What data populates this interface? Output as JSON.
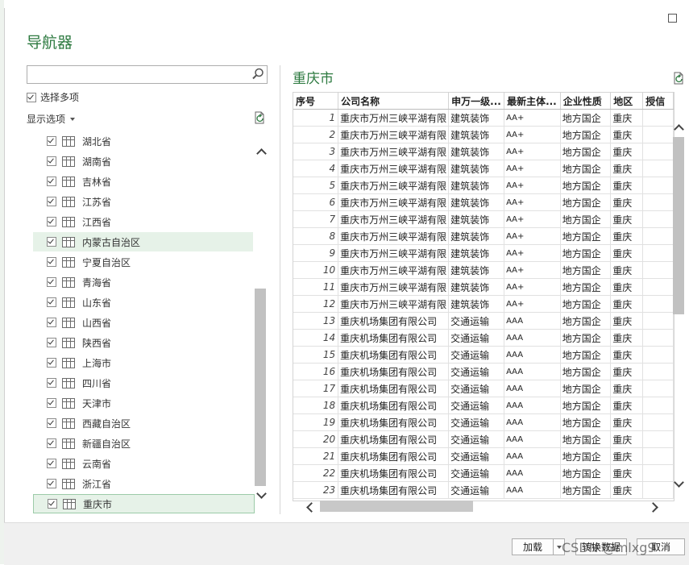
{
  "dialog": {
    "title": "导航器"
  },
  "left": {
    "search_placeholder": "",
    "select_multiple_label": "选择多项",
    "display_options_label": "显示选项",
    "items": [
      {
        "label": "湖北省",
        "checked": true
      },
      {
        "label": "湖南省",
        "checked": true
      },
      {
        "label": "吉林省",
        "checked": true
      },
      {
        "label": "江苏省",
        "checked": true
      },
      {
        "label": "江西省",
        "checked": true
      },
      {
        "label": "内蒙古自治区",
        "checked": true,
        "state": "hover"
      },
      {
        "label": "宁夏自治区",
        "checked": true
      },
      {
        "label": "青海省",
        "checked": true
      },
      {
        "label": "山东省",
        "checked": true
      },
      {
        "label": "山西省",
        "checked": true
      },
      {
        "label": "陕西省",
        "checked": true
      },
      {
        "label": "上海市",
        "checked": true
      },
      {
        "label": "四川省",
        "checked": true
      },
      {
        "label": "天津市",
        "checked": true
      },
      {
        "label": "西藏自治区",
        "checked": true
      },
      {
        "label": "新疆自治区",
        "checked": true
      },
      {
        "label": "云南省",
        "checked": true
      },
      {
        "label": "浙江省",
        "checked": true
      },
      {
        "label": "重庆市",
        "checked": true,
        "state": "selected"
      }
    ]
  },
  "preview": {
    "title": "重庆市",
    "columns": [
      "序号",
      "公司名称",
      "申万一级...",
      "最新主体...",
      "企业性质",
      "地区",
      "授信"
    ],
    "rows": [
      [
        "1",
        "重庆市万州三峡平湖有限",
        "建筑装饰",
        "AA+",
        "地方国企",
        "重庆"
      ],
      [
        "2",
        "重庆市万州三峡平湖有限",
        "建筑装饰",
        "AA+",
        "地方国企",
        "重庆"
      ],
      [
        "3",
        "重庆市万州三峡平湖有限",
        "建筑装饰",
        "AA+",
        "地方国企",
        "重庆"
      ],
      [
        "4",
        "重庆市万州三峡平湖有限",
        "建筑装饰",
        "AA+",
        "地方国企",
        "重庆"
      ],
      [
        "5",
        "重庆市万州三峡平湖有限",
        "建筑装饰",
        "AA+",
        "地方国企",
        "重庆"
      ],
      [
        "6",
        "重庆市万州三峡平湖有限",
        "建筑装饰",
        "AA+",
        "地方国企",
        "重庆"
      ],
      [
        "7",
        "重庆市万州三峡平湖有限",
        "建筑装饰",
        "AA+",
        "地方国企",
        "重庆"
      ],
      [
        "8",
        "重庆市万州三峡平湖有限",
        "建筑装饰",
        "AA+",
        "地方国企",
        "重庆"
      ],
      [
        "9",
        "重庆市万州三峡平湖有限",
        "建筑装饰",
        "AA+",
        "地方国企",
        "重庆"
      ],
      [
        "10",
        "重庆市万州三峡平湖有限",
        "建筑装饰",
        "AA+",
        "地方国企",
        "重庆"
      ],
      [
        "11",
        "重庆市万州三峡平湖有限",
        "建筑装饰",
        "AA+",
        "地方国企",
        "重庆"
      ],
      [
        "12",
        "重庆市万州三峡平湖有限",
        "建筑装饰",
        "AA+",
        "地方国企",
        "重庆"
      ],
      [
        "13",
        "重庆机场集团有限公司",
        "交通运输",
        "AAA",
        "地方国企",
        "重庆"
      ],
      [
        "14",
        "重庆机场集团有限公司",
        "交通运输",
        "AAA",
        "地方国企",
        "重庆"
      ],
      [
        "15",
        "重庆机场集团有限公司",
        "交通运输",
        "AAA",
        "地方国企",
        "重庆"
      ],
      [
        "16",
        "重庆机场集团有限公司",
        "交通运输",
        "AAA",
        "地方国企",
        "重庆"
      ],
      [
        "17",
        "重庆机场集团有限公司",
        "交通运输",
        "AAA",
        "地方国企",
        "重庆"
      ],
      [
        "18",
        "重庆机场集团有限公司",
        "交通运输",
        "AAA",
        "地方国企",
        "重庆"
      ],
      [
        "19",
        "重庆机场集团有限公司",
        "交通运输",
        "AAA",
        "地方国企",
        "重庆"
      ],
      [
        "20",
        "重庆机场集团有限公司",
        "交通运输",
        "AAA",
        "地方国企",
        "重庆"
      ],
      [
        "21",
        "重庆机场集团有限公司",
        "交通运输",
        "AAA",
        "地方国企",
        "重庆"
      ],
      [
        "22",
        "重庆机场集团有限公司",
        "交通运输",
        "AAA",
        "地方国企",
        "重庆"
      ],
      [
        "23",
        "重庆机场集团有限公司",
        "交通运输",
        "AAA",
        "地方国企",
        "重庆"
      ]
    ]
  },
  "footer": {
    "load_label": "加载",
    "transform_label": "转换数据",
    "cancel_label": "取消",
    "watermark": "CSDN @mlxg9"
  },
  "colors": {
    "accent": "#2d7a40",
    "selection": "#e6f2e8"
  },
  "icons": [
    "search-icon",
    "refresh-icon",
    "table-icon",
    "checkbox-icon",
    "dropdown-caret-icon",
    "restore-window-icon"
  ]
}
